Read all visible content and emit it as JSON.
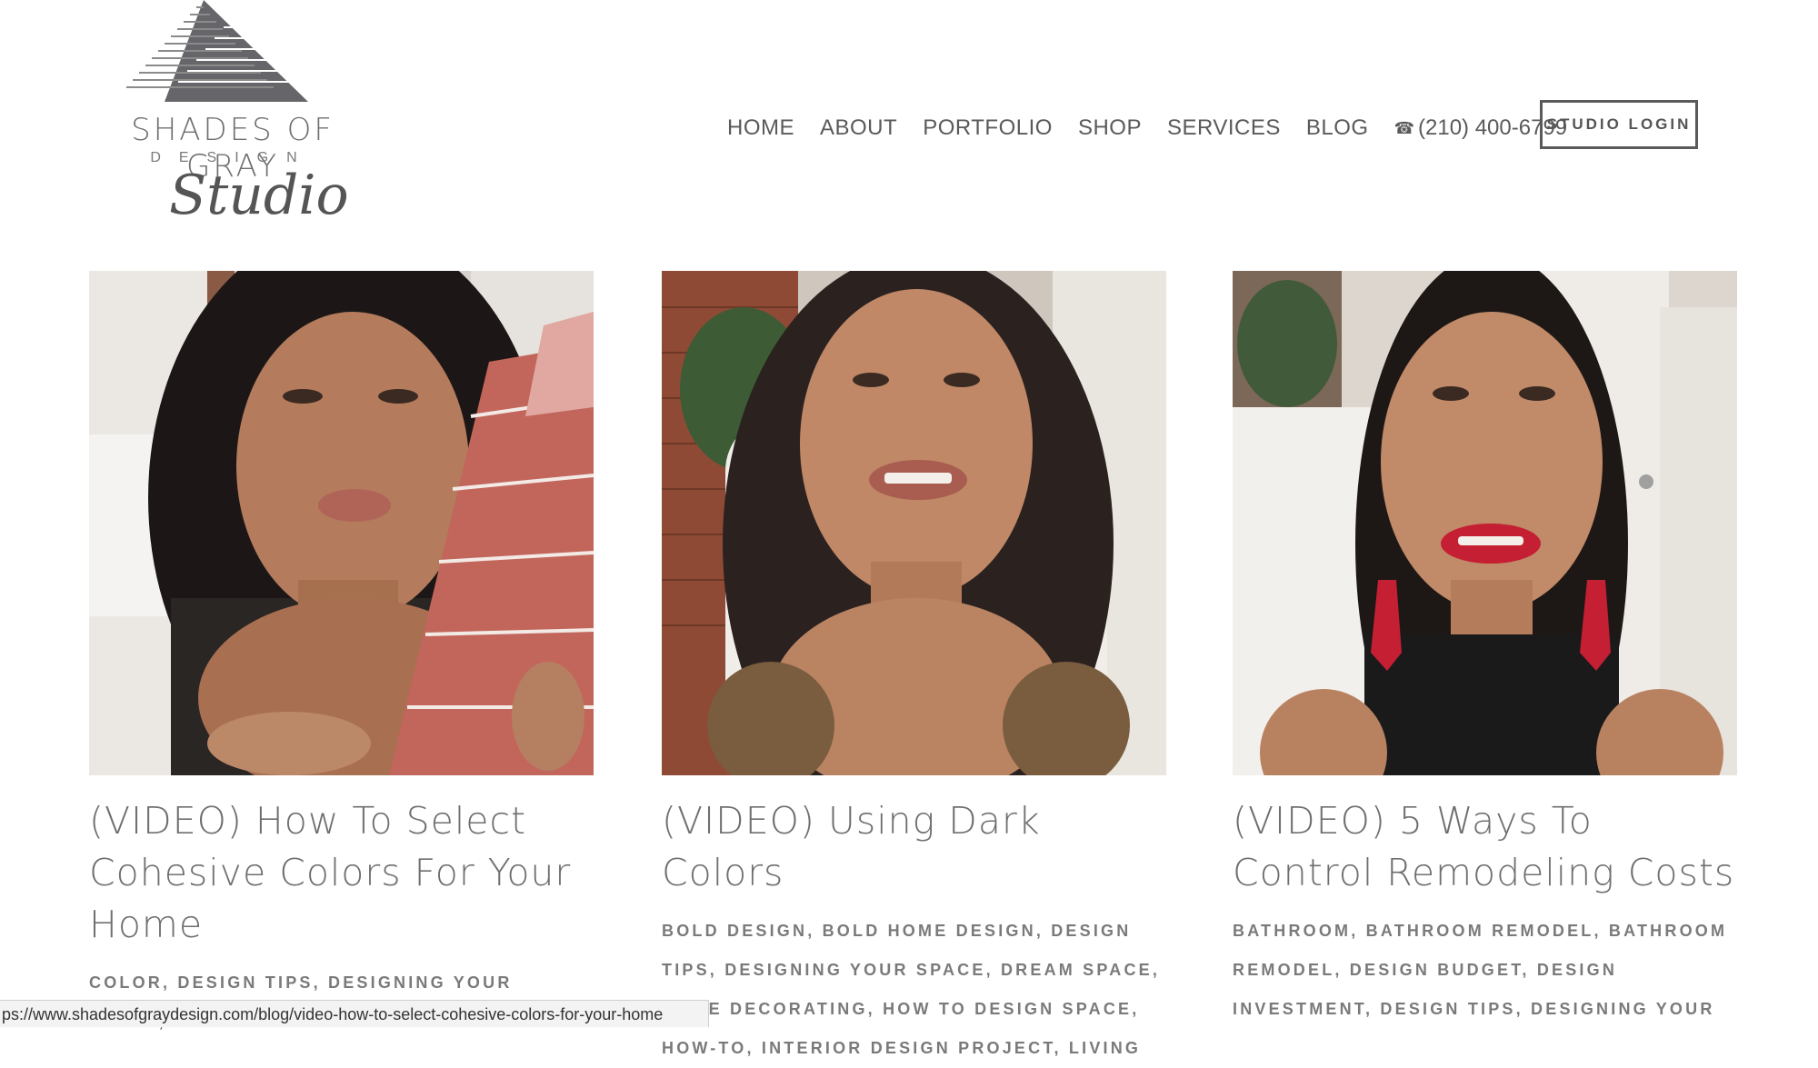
{
  "brand": {
    "name": "SHADES OF GRAY",
    "sub": "DESIGN",
    "script": "Studio"
  },
  "nav": {
    "items": [
      "HOME",
      "ABOUT",
      "PORTFOLIO",
      "SHOP",
      "SERVICES",
      "BLOG"
    ],
    "phone": "(210) 400-6799",
    "login": "STUDIO LOGIN"
  },
  "posts": [
    {
      "title": "(VIDEO) How To Select Cohesive Colors For Your Home",
      "tags": "COLOR, DESIGN TIPS, DESIGNING YOUR SPACE,"
    },
    {
      "title": "(VIDEO) Using Dark Colors",
      "tags": "BOLD DESIGN, BOLD HOME DESIGN, DESIGN TIPS, DESIGNING YOUR SPACE, DREAM SPACE, HOME DECORATING, HOW TO DESIGN SPACE, HOW-TO, INTERIOR DESIGN PROJECT, LIVING"
    },
    {
      "title": "(VIDEO) 5 Ways To Control Remodeling Costs",
      "tags": "BATHROOM, BATHROOM REMODEL, BATHROOM REMODEL, DESIGN BUDGET, DESIGN INVESTMENT, DESIGN TIPS, DESIGNING YOUR"
    }
  ],
  "status_url": "ps://www.shadesofgraydesign.com/blog/video-how-to-select-cohesive-colors-for-your-home",
  "colors": {
    "text": "#6b6b6b",
    "logo_triangle": "#66666a",
    "lipstick": "#c41f33",
    "paint_swatch": "#c2665b"
  }
}
